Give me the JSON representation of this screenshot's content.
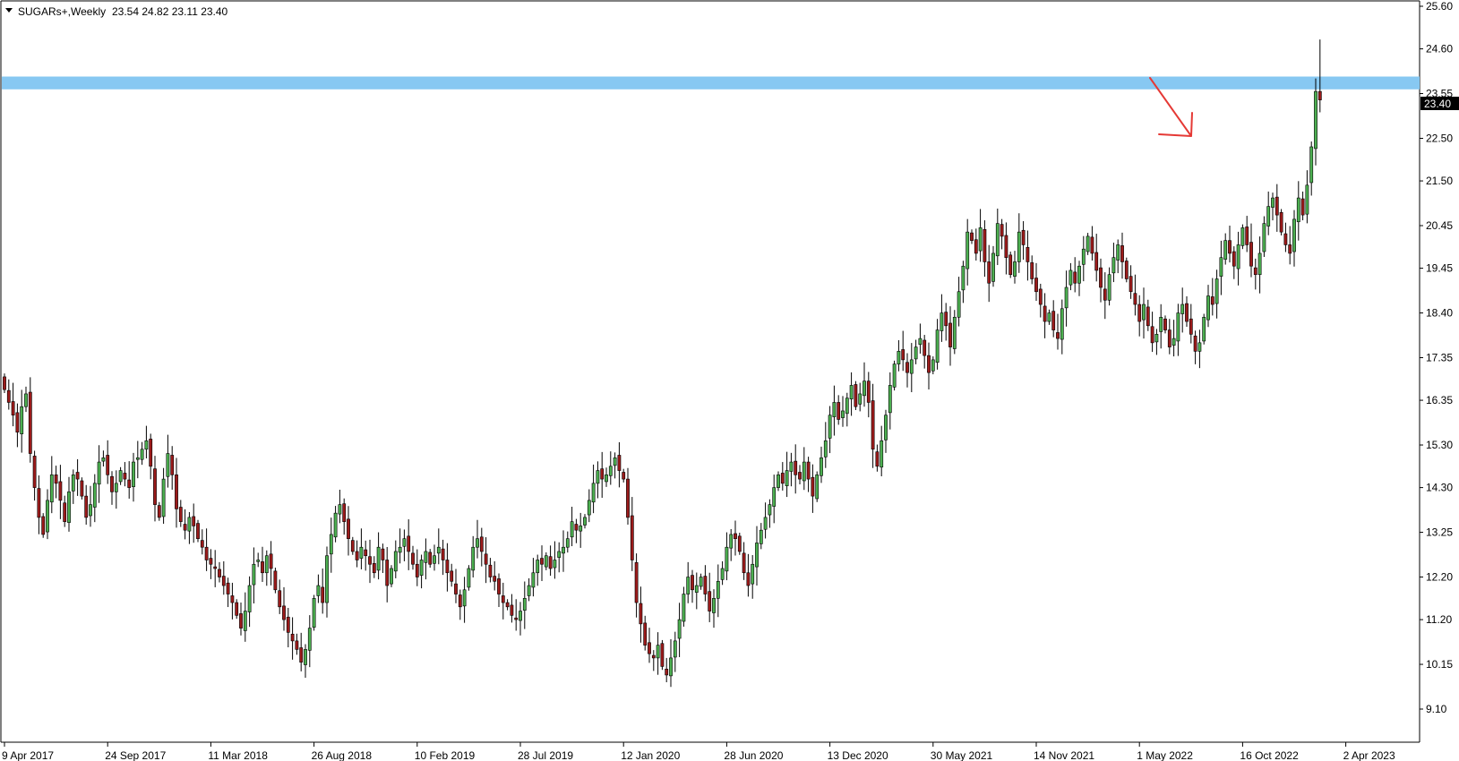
{
  "header": {
    "dropdown_icon": "triangle-down-icon",
    "symbol": "SUGARs+,Weekly",
    "ohlc": "23.54 24.82 23.11 23.40"
  },
  "current_price_label": "23.40",
  "colors": {
    "bull_candle": "#4caf50",
    "bear_candle": "#9b1b1b",
    "wick": "#000000",
    "resistance_zone": "#87c8f2",
    "annotation_arrow": "#e53935",
    "price_tag_bg": "#000000",
    "price_tag_text": "#ffffff",
    "background": "#ffffff"
  },
  "chart_data": {
    "type": "candlestick",
    "title": "SUGARs+,Weekly",
    "y_axis": {
      "ticks": [
        "25.60",
        "24.60",
        "23.55",
        "22.50",
        "21.50",
        "20.45",
        "19.45",
        "18.40",
        "17.35",
        "16.35",
        "15.30",
        "14.30",
        "13.25",
        "12.20",
        "11.20",
        "10.15",
        "9.10"
      ],
      "range": [
        8.6,
        25.9
      ],
      "position": "right"
    },
    "x_axis": {
      "ticks": [
        "9 Apr 2017",
        "24 Sep 2017",
        "11 Mar 2018",
        "26 Aug 2018",
        "10 Feb 2019",
        "28 Jul 2019",
        "12 Jan 2020",
        "28 Jun 2020",
        "13 Dec 2020",
        "30 May 2021",
        "14 Nov 2021",
        "1 May 2022",
        "16 Oct 2022",
        "2 Apr 2023"
      ],
      "weeks_between_ticks": 24
    },
    "closes": [
      16.6,
      16.3,
      16.0,
      15.6,
      16.2,
      16.5,
      15.1,
      14.3,
      13.6,
      13.2,
      14.0,
      14.6,
      14.4,
      14.0,
      13.5,
      14.2,
      14.6,
      14.5,
      14.1,
      13.6,
      13.9,
      14.4,
      14.9,
      15.0,
      14.6,
      14.2,
      14.4,
      14.7,
      14.5,
      14.3,
      14.9,
      15.0,
      15.2,
      15.4,
      14.8,
      13.9,
      13.6,
      14.5,
      15.1,
      14.6,
      13.8,
      13.5,
      13.3,
      13.6,
      13.4,
      13.1,
      12.9,
      12.6,
      12.5,
      12.4,
      12.2,
      12.0,
      11.8,
      11.6,
      11.3,
      11.0,
      11.4,
      12.0,
      12.5,
      12.6,
      12.3,
      12.7,
      12.4,
      11.9,
      11.5,
      11.2,
      10.9,
      10.7,
      10.5,
      10.2,
      10.5,
      11.0,
      11.7,
      12.0,
      11.6,
      12.7,
      13.2,
      13.7,
      13.9,
      13.5,
      13.1,
      12.8,
      12.6,
      12.9,
      12.7,
      12.5,
      12.3,
      12.9,
      12.6,
      12.0,
      12.4,
      12.8,
      12.9,
      13.1,
      12.8,
      12.5,
      12.2,
      12.6,
      12.8,
      12.5,
      12.7,
      12.9,
      12.6,
      12.3,
      12.1,
      11.8,
      11.5,
      11.9,
      12.4,
      12.9,
      13.1,
      12.8,
      12.5,
      12.2,
      12.1,
      11.8,
      11.6,
      11.5,
      11.3,
      11.2,
      11.4,
      11.7,
      12.0,
      12.3,
      12.6,
      12.5,
      12.7,
      12.4,
      12.6,
      12.8,
      12.9,
      13.1,
      13.5,
      13.3,
      13.4,
      13.6,
      14.0,
      14.4,
      14.7,
      14.5,
      14.6,
      14.8,
      15.0,
      14.7,
      14.5,
      13.6,
      12.6,
      11.6,
      11.1,
      10.6,
      10.4,
      10.3,
      10.6,
      10.1,
      9.9,
      10.3,
      10.7,
      11.2,
      11.8,
      12.2,
      11.9,
      12.0,
      12.2,
      11.8,
      11.4,
      11.7,
      12.1,
      12.4,
      12.9,
      13.2,
      13.1,
      12.8,
      12.3,
      12.0,
      12.5,
      13.0,
      13.3,
      13.6,
      13.9,
      14.3,
      14.6,
      14.4,
      14.7,
      14.9,
      14.6,
      14.5,
      14.9,
      14.5,
      14.1,
      14.6,
      15.0,
      15.4,
      16.0,
      16.3,
      15.9,
      16.1,
      16.4,
      16.7,
      16.2,
      16.5,
      16.8,
      16.3,
      15.2,
      14.8,
      15.4,
      16.0,
      16.7,
      17.2,
      17.5,
      17.3,
      17.0,
      17.3,
      17.6,
      17.8,
      17.4,
      17.0,
      17.3,
      18.0,
      18.4,
      18.1,
      17.6,
      18.3,
      18.9,
      19.5,
      20.3,
      20.1,
      19.8,
      20.4,
      19.6,
      19.1,
      19.8,
      20.5,
      20.2,
      19.7,
      19.3,
      19.6,
      20.3,
      20.0,
      19.6,
      19.2,
      18.9,
      18.6,
      18.2,
      18.4,
      18.0,
      17.8,
      18.5,
      19.0,
      19.4,
      19.1,
      19.5,
      19.9,
      20.2,
      19.8,
      19.4,
      19.0,
      18.7,
      19.3,
      19.7,
      20.0,
      19.6,
      19.2,
      18.9,
      18.6,
      18.2,
      18.6,
      18.1,
      17.7,
      17.9,
      18.3,
      18.0,
      17.6,
      17.8,
      18.4,
      18.6,
      18.2,
      17.9,
      17.5,
      17.7,
      18.3,
      18.8,
      18.6,
      19.2,
      19.7,
      20.1,
      19.8,
      19.5,
      20.0,
      20.4,
      20.0,
      19.5,
      19.3,
      19.8,
      20.5,
      20.9,
      21.1,
      20.7,
      20.3,
      20.0,
      19.8,
      20.6,
      21.1,
      20.7,
      21.4,
      22.3,
      23.6,
      23.4
    ],
    "notable_wicks": {
      "last_high": 24.82,
      "last_low": 23.11,
      "first_open": 16.9
    },
    "annotations": [
      {
        "type": "horizontal_zone",
        "from": 23.65,
        "to": 23.95
      },
      {
        "type": "arrow",
        "direction": "down-right"
      }
    ]
  }
}
